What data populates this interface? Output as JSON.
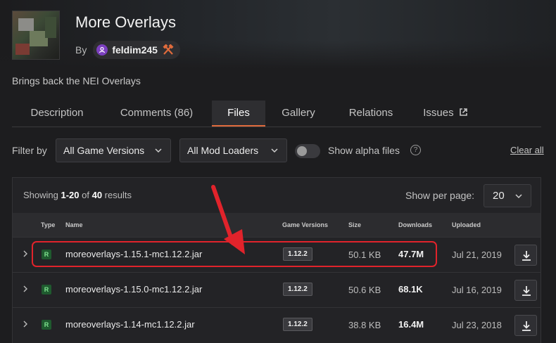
{
  "project": {
    "title": "More Overlays",
    "by_label": "By",
    "author": "feldim245",
    "summary": "Brings back the NEI Overlays"
  },
  "tabs": [
    {
      "label": "Description",
      "active": false
    },
    {
      "label": "Comments (86)",
      "active": false
    },
    {
      "label": "Files",
      "active": true
    },
    {
      "label": "Gallery",
      "active": false
    },
    {
      "label": "Relations",
      "active": false
    },
    {
      "label": "Issues",
      "active": false
    }
  ],
  "filters": {
    "label": "Filter by",
    "game_versions": "All Game Versions",
    "mod_loaders": "All Mod Loaders",
    "alpha_label": "Show alpha files",
    "alpha_enabled": false,
    "help": "?",
    "clear_all": "Clear all"
  },
  "results": {
    "showing_prefix": "Showing ",
    "range": "1-20",
    "of": " of ",
    "total": "40",
    "suffix": " results",
    "per_page_label": "Show per page:",
    "per_page": "20"
  },
  "table": {
    "headers": {
      "type": "Type",
      "name": "Name",
      "game_versions": "Game Versions",
      "size": "Size",
      "downloads": "Downloads",
      "uploaded": "Uploaded"
    },
    "rows": [
      {
        "type": "R",
        "name": "moreoverlays-1.15.1-mc1.12.2.jar",
        "version": "1.12.2",
        "size": "50.1 KB",
        "downloads": "47.7M",
        "uploaded": "Jul 21, 2019"
      },
      {
        "type": "R",
        "name": "moreoverlays-1.15.0-mc1.12.2.jar",
        "version": "1.12.2",
        "size": "50.6 KB",
        "downloads": "68.1K",
        "uploaded": "Jul 16, 2019"
      },
      {
        "type": "R",
        "name": "moreoverlays-1.14-mc1.12.2.jar",
        "version": "1.12.2",
        "size": "38.8 KB",
        "downloads": "16.4M",
        "uploaded": "Jul 23, 2018"
      }
    ]
  },
  "colors": {
    "accent": "#e06b3c",
    "annotation_red": "#e1232b",
    "release_badge": "#1f5a2f"
  }
}
